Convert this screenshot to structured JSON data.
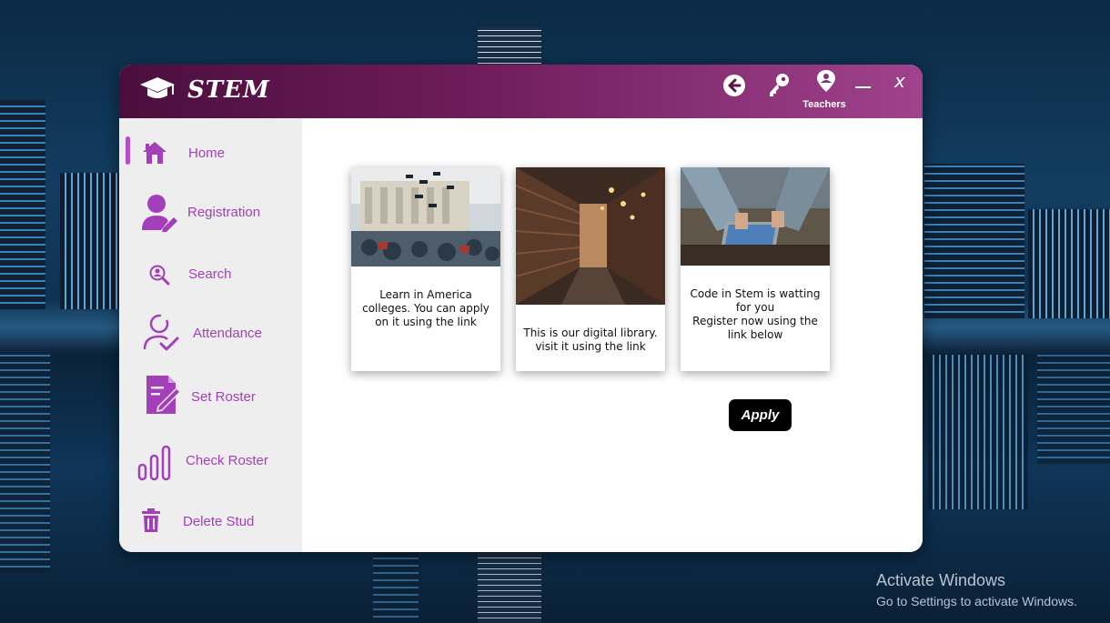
{
  "app": {
    "title": "STEM"
  },
  "titlebar": {
    "back_icon": "arrow-left-circle-icon",
    "key_icon": "key-icon",
    "teachers_label": "Teachers",
    "teachers_icon": "user-pin-icon",
    "minimize_label": "—",
    "close_label": "x"
  },
  "sidebar": {
    "items": [
      {
        "label": "Home",
        "icon": "home-icon",
        "active": true
      },
      {
        "label": "Registration",
        "icon": "user-edit-icon"
      },
      {
        "label": "Search",
        "icon": "search-person-icon"
      },
      {
        "label": "Attendance",
        "icon": "user-check-icon"
      },
      {
        "label": "Set Roster",
        "icon": "document-edit-icon"
      },
      {
        "label": "Check Roster",
        "icon": "bar-chart-icon"
      },
      {
        "label": "Delete Stud",
        "icon": "trash-icon"
      }
    ]
  },
  "cards": [
    {
      "text": "Learn in America colleges. You can apply on it using the link",
      "image": "graduation-photo"
    },
    {
      "text": "This is our digital library. visit it using the link",
      "image": "library-photo"
    },
    {
      "text": "Code in Stem is watting for you\nRegister now using the link below",
      "image": "laptop-photo"
    }
  ],
  "apply_button": {
    "label": "Apply"
  },
  "watermark": {
    "line1": "Activate Windows",
    "line2": "Go to Settings to activate Windows."
  },
  "colors": {
    "accent": "#a33fb8",
    "titlebar_start": "#4a0e3c",
    "titlebar_end": "#a0428d",
    "sidebar_bg": "#efeeef"
  }
}
